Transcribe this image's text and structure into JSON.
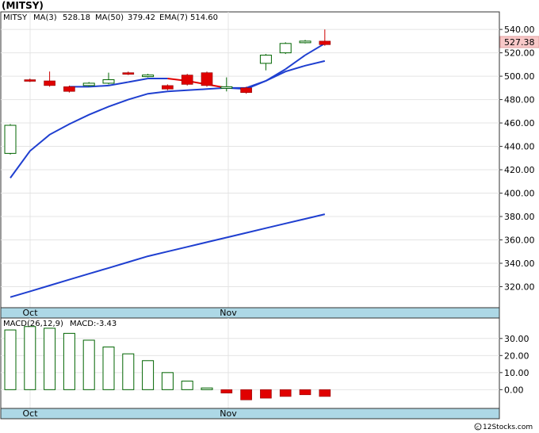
{
  "title": "(MITSY)",
  "chart_data": [
    {
      "type": "candlestick",
      "ticker_label": "MITSY",
      "indicators": {
        "ma3_label": "MA(3)",
        "ma3_value": "528.18",
        "ma50_label": "MA(50)",
        "ma50_value": "379.42",
        "ema7_label": "EMA(7)",
        "ema7_value": "514.60"
      },
      "last_price_label": "527.38",
      "ylim": [
        302,
        555
      ],
      "y_ticks": [
        "540.00",
        "520.00",
        "500.00",
        "480.00",
        "460.00",
        "440.00",
        "420.00",
        "400.00",
        "380.00",
        "360.00",
        "340.00",
        "320.00"
      ],
      "x_ticks": [
        "Oct",
        "Nov"
      ],
      "grid": true,
      "candles": [
        {
          "open": 434,
          "close": 458,
          "high": 459,
          "low": 433,
          "color": "up"
        },
        {
          "open": 497,
          "close": 496,
          "high": 498,
          "low": 495,
          "color": "down"
        },
        {
          "open": 496,
          "close": 492,
          "high": 504,
          "low": 491,
          "color": "down"
        },
        {
          "open": 491,
          "close": 487,
          "high": 492,
          "low": 486,
          "color": "down"
        },
        {
          "open": 492,
          "close": 494,
          "high": 495,
          "low": 491,
          "color": "up"
        },
        {
          "open": 494,
          "close": 497,
          "high": 503,
          "low": 493,
          "color": "up"
        },
        {
          "open": 502,
          "close": 503,
          "high": 504,
          "low": 501,
          "color": "down"
        },
        {
          "open": 500,
          "close": 501,
          "high": 502,
          "low": 499,
          "color": "up"
        },
        {
          "open": 492,
          "close": 489,
          "high": 493,
          "low": 488,
          "color": "down"
        },
        {
          "open": 501,
          "close": 493,
          "high": 502,
          "low": 492,
          "color": "down"
        },
        {
          "open": 503,
          "close": 492,
          "high": 504,
          "low": 491,
          "color": "down"
        },
        {
          "open": 490,
          "close": 491,
          "high": 499,
          "low": 487,
          "color": "up"
        },
        {
          "open": 490,
          "close": 486,
          "high": 491,
          "low": 485,
          "color": "down"
        },
        {
          "open": 511,
          "close": 518,
          "high": 519,
          "low": 505,
          "color": "up"
        },
        {
          "open": 520,
          "close": 528,
          "high": 529,
          "low": 519,
          "color": "up"
        },
        {
          "open": 529,
          "close": 530,
          "high": 531,
          "low": 528,
          "color": "up"
        },
        {
          "open": 530,
          "close": 527,
          "high": 540,
          "low": 526,
          "color": "down"
        }
      ],
      "ma3": [
        null,
        null,
        null,
        491,
        491,
        492,
        495,
        498,
        498,
        496,
        493,
        490,
        490,
        496,
        506,
        518,
        528
      ],
      "ema7": [
        413,
        436,
        450,
        459,
        467,
        474,
        480,
        485,
        487,
        488,
        489,
        490,
        489,
        496,
        504,
        509,
        513
      ],
      "ma50": [
        311,
        316,
        321,
        326,
        331,
        336,
        341,
        346,
        350,
        354,
        358,
        362,
        366,
        370,
        374,
        378,
        382
      ]
    },
    {
      "type": "bar",
      "title": "MACD(26,12,9)",
      "value_label": "MACD:-3.43",
      "ylim": [
        -11,
        42
      ],
      "y_ticks": [
        "30.00",
        "20.00",
        "10.00",
        "0.00"
      ],
      "x_ticks": [
        "Oct",
        "Nov"
      ],
      "values": [
        35,
        37,
        36,
        33,
        29,
        25,
        21,
        17,
        10,
        5,
        1,
        -2,
        -6,
        -5,
        -4,
        -3,
        -4
      ]
    }
  ]
}
